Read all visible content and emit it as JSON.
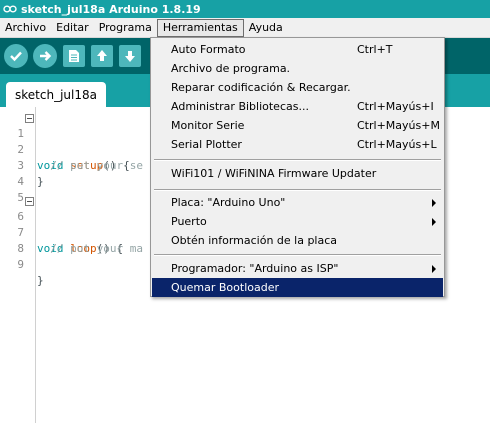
{
  "window": {
    "title": "sketch_jul18a Arduino 1.8.19",
    "icon": "arduino-infinity-icon"
  },
  "menubar": {
    "items": [
      "Archivo",
      "Editar",
      "Programa",
      "Herramientas",
      "Ayuda"
    ],
    "active": "Herramientas"
  },
  "toolbar": {
    "buttons": [
      "verify-icon",
      "upload-icon",
      "new-icon",
      "open-icon",
      "save-icon"
    ]
  },
  "tabs": [
    {
      "label": "sketch_jul18a"
    }
  ],
  "editor": {
    "lines": [
      {
        "n": "1",
        "fold": true
      },
      {
        "n": "2"
      },
      {
        "n": "3"
      },
      {
        "n": "4"
      },
      {
        "n": "5"
      },
      {
        "n": "6",
        "fold": true
      },
      {
        "n": "7"
      },
      {
        "n": "8"
      },
      {
        "n": "9"
      }
    ],
    "code": {
      "l1_kw": "void",
      "l1_fn": "setup",
      "l1_rest": "() {",
      "l2_cm": "// put your se",
      "l4": "}",
      "l6_kw": "void",
      "l6_fn": "loop",
      "l6_rest": "() {",
      "l7_cm": "// put your ma",
      "l9": "}"
    }
  },
  "dropdown": {
    "items": [
      {
        "label": "Auto Formato",
        "shortcut": "Ctrl+T"
      },
      {
        "label": "Archivo de programa.",
        "shortcut": ""
      },
      {
        "label": "Reparar codificación & Recargar.",
        "shortcut": ""
      },
      {
        "label": "Administrar Bibliotecas...",
        "shortcut": "Ctrl+Mayús+I"
      },
      {
        "label": "Monitor Serie",
        "shortcut": "Ctrl+Mayús+M"
      },
      {
        "label": "Serial Plotter",
        "shortcut": "Ctrl+Mayús+L"
      },
      {
        "label": "WiFi101 / WiFiNINA Firmware Updater",
        "shortcut": ""
      },
      {
        "label": "Placa: \"Arduino Uno\"",
        "submenu": true
      },
      {
        "label": "Puerto",
        "submenu": true
      },
      {
        "label": "Obtén información de la placa"
      },
      {
        "label": "Programador: \"Arduino as ISP\"",
        "submenu": true
      },
      {
        "label": "Quemar Bootloader",
        "selected": true
      }
    ]
  },
  "colors": {
    "teal": "#17a1a5",
    "toolbar_dark": "#006468",
    "selection": "#0a246a"
  }
}
